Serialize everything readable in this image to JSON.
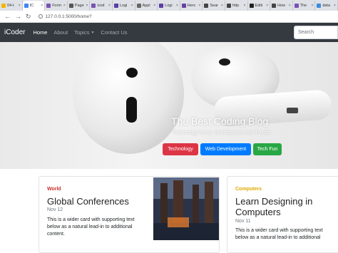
{
  "browser": {
    "tabs": [
      {
        "label": "04-t",
        "color": "#f4b400",
        "active": false
      },
      {
        "label": "IC",
        "color": "#4285f4",
        "active": true
      },
      {
        "label": "Form",
        "color": "#7952b3",
        "active": false
      },
      {
        "label": "Page",
        "color": "#555555",
        "active": false
      },
      {
        "label": "icod",
        "color": "#7952b3",
        "active": false
      },
      {
        "label": "Logi",
        "color": "#5b3ea6",
        "active": false
      },
      {
        "label": "Appl",
        "color": "#666666",
        "active": false
      },
      {
        "label": "Logi",
        "color": "#5b3ea6",
        "active": false
      },
      {
        "label": "Herc",
        "color": "#6b3fa0",
        "active": false
      },
      {
        "label": "Sear",
        "color": "#444444",
        "active": false
      },
      {
        "label": "http",
        "color": "#444444",
        "active": false
      },
      {
        "label": "Editi",
        "color": "#222222",
        "active": false
      },
      {
        "label": "How",
        "color": "#444444",
        "active": false
      },
      {
        "label": "The",
        "color": "#7952b3",
        "active": false
      },
      {
        "label": "data",
        "color": "#3c8dde",
        "active": false
      }
    ],
    "url": "127.0.0.1:5000/home?"
  },
  "navbar": {
    "brand": "iCoder",
    "links": [
      "Home",
      "About",
      "Topics",
      "Contact Us"
    ],
    "search_placeholder": "Search"
  },
  "hero": {
    "title": "The Best Coding Blog",
    "subtitle": "Technology News, Development and Trends",
    "buttons": [
      {
        "label": "Technology",
        "color": "#dc3545"
      },
      {
        "label": "Web Development",
        "color": "#007bff"
      },
      {
        "label": "Tech Fun",
        "color": "#28a745"
      }
    ]
  },
  "cards": [
    {
      "category": "World",
      "category_color": "#c9302c",
      "title": "Global Conferences",
      "date": "Nov 12",
      "text_lines": [
        "This is a wider card with supporting text",
        "below as a natural lead-in to additional",
        "content."
      ]
    },
    {
      "category": "Computers",
      "category_color": "#e0a800",
      "title_lines": [
        "Learn Designing in",
        "Computers"
      ],
      "date": "Nov 11",
      "text_lines": [
        "This is a wider card with supporting text",
        "below as a natural lead-in to additional"
      ]
    }
  ]
}
